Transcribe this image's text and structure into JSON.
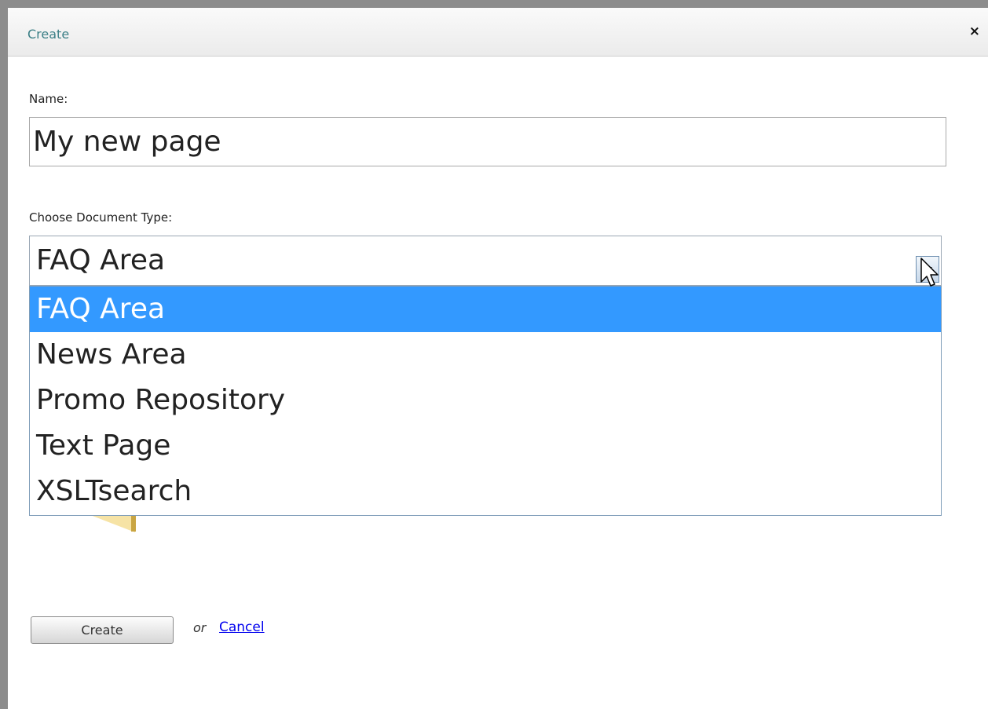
{
  "dialog": {
    "title": "Create",
    "close_symbol": "×"
  },
  "form": {
    "name_label": "Name:",
    "name_value": "My new page",
    "doctype_label": "Choose Document Type:",
    "doctype_selected": "FAQ Area",
    "doctype_options": [
      "FAQ Area",
      "News Area",
      "Promo Repository",
      "Text Page",
      "XSLTsearch"
    ],
    "highlighted_option": "FAQ Area"
  },
  "actions": {
    "create_label": "Create",
    "or_text": "or",
    "cancel_label": "Cancel"
  },
  "colors": {
    "title_text": "#3b7f86",
    "highlight": "#3399ff",
    "link": "#0000ee"
  }
}
